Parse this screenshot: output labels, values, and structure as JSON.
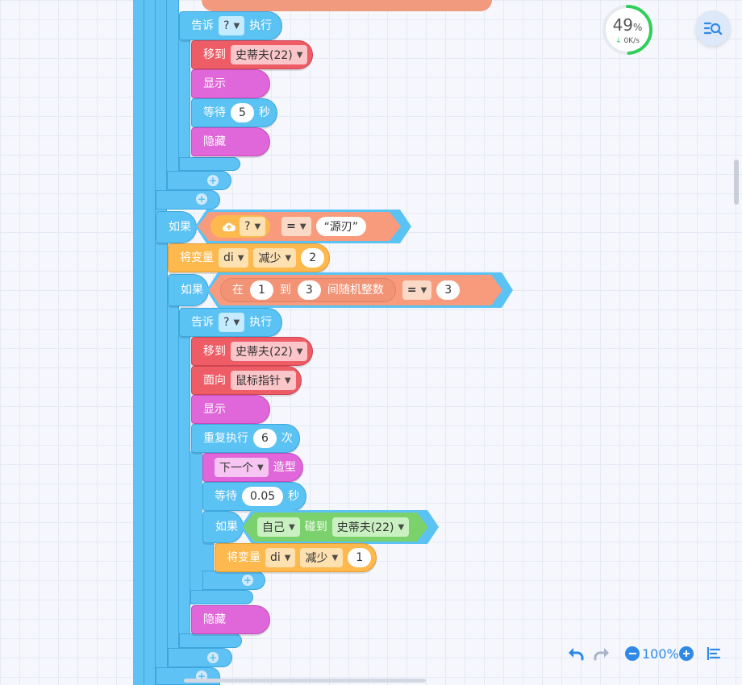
{
  "colors": {
    "control_blue": "#5bc2f4",
    "motion_red": "#ee5d66",
    "looks_pink": "#e067d9",
    "variable_orange": "#fdb94d",
    "operator_salmon": "#f79b7c",
    "sensing_green": "#7bd16b",
    "accent": "#2f8ae6"
  },
  "icons": {
    "top_right": "search-list-icon",
    "undo": "undo-icon",
    "redo": "redo-icon",
    "zoom_out": "minus-circle-icon",
    "zoom_in": "plus-circle-icon",
    "align": "align-left-icon",
    "cloud": "cloud-upload-icon"
  },
  "monitor": {
    "percent": "49",
    "percent_sign": "%",
    "rate": "0K/s",
    "rate_arrow": "↓"
  },
  "zoom": {
    "level": "100%"
  },
  "blocks": {
    "tell_1": {
      "label": "告诉",
      "target": "?",
      "suffix": "执行"
    },
    "move_1": {
      "label": "移到",
      "target": "史蒂夫(22)"
    },
    "show_1": {
      "label": "显示"
    },
    "wait_1": {
      "label": "等待",
      "value": "5",
      "unit": "秒"
    },
    "hide_1": {
      "label": "隐藏"
    },
    "if_1": {
      "label": "如果",
      "sensor": "?",
      "op": "=",
      "value": "“源刃”"
    },
    "setvar_1": {
      "label": "将变量",
      "var": "di",
      "mode": "减少",
      "value": "2"
    },
    "if_2": {
      "label": "如果",
      "pre": "在",
      "from": "1",
      "to_label": "到",
      "to": "3",
      "post": "间随机整数",
      "op": "=",
      "value": "3"
    },
    "tell_2": {
      "label": "告诉",
      "target": "?",
      "suffix": "执行"
    },
    "move_2": {
      "label": "移到",
      "target": "史蒂夫(22)"
    },
    "face_2": {
      "label": "面向",
      "target": "鼠标指针"
    },
    "show_2": {
      "label": "显示"
    },
    "repeat_2": {
      "label": "重复执行",
      "value": "6",
      "unit": "次"
    },
    "costume_2": {
      "target": "下一个",
      "label": "造型"
    },
    "wait_2": {
      "label": "等待",
      "value": "0.05",
      "unit": "秒"
    },
    "if_3": {
      "label": "如果",
      "subject": "自己",
      "touch_label": "碰到",
      "target": "史蒂夫(22)"
    },
    "setvar_2": {
      "label": "将变量",
      "var": "di",
      "mode": "减少",
      "value": "1"
    },
    "hide_2": {
      "label": "隐藏"
    }
  }
}
